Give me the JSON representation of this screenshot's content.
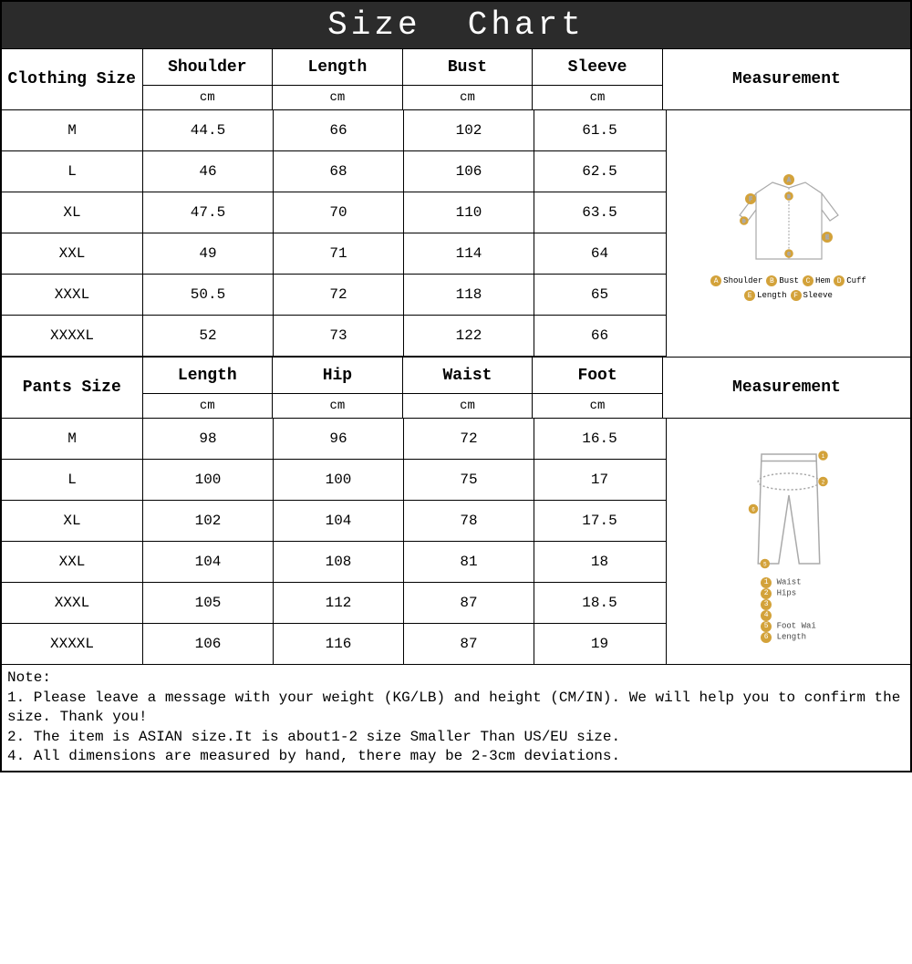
{
  "title": "Size  Chart",
  "clothing": {
    "sizeLabel": "Clothing Size",
    "headers": [
      "Shoulder",
      "Length",
      "Bust",
      "Sleeve"
    ],
    "unit": "cm",
    "measurementLabel": "Measurement",
    "rows": [
      {
        "size": "M",
        "v": [
          "44.5",
          "66",
          "102",
          "61.5"
        ]
      },
      {
        "size": "L",
        "v": [
          "46",
          "68",
          "106",
          "62.5"
        ]
      },
      {
        "size": "XL",
        "v": [
          "47.5",
          "70",
          "110",
          "63.5"
        ]
      },
      {
        "size": "XXL",
        "v": [
          "49",
          "71",
          "114",
          "64"
        ]
      },
      {
        "size": "XXXL",
        "v": [
          "50.5",
          "72",
          "118",
          "65"
        ]
      },
      {
        "size": "XXXXL",
        "v": [
          "52",
          "73",
          "122",
          "66"
        ]
      }
    ],
    "legend": [
      {
        "k": "A",
        "t": "Shoulder"
      },
      {
        "k": "B",
        "t": "Bust"
      },
      {
        "k": "C",
        "t": "Hem"
      },
      {
        "k": "D",
        "t": "Cuff"
      },
      {
        "k": "E",
        "t": "Length"
      },
      {
        "k": "F",
        "t": "Sleeve"
      }
    ]
  },
  "pants": {
    "sizeLabel": "Pants Size",
    "headers": [
      "Length",
      "Hip",
      "Waist",
      "Foot"
    ],
    "unit": "cm",
    "measurementLabel": "Measurement",
    "rows": [
      {
        "size": "M",
        "v": [
          "98",
          "96",
          "72",
          "16.5"
        ]
      },
      {
        "size": "L",
        "v": [
          "100",
          "100",
          "75",
          "17"
        ]
      },
      {
        "size": "XL",
        "v": [
          "102",
          "104",
          "78",
          "17.5"
        ]
      },
      {
        "size": "XXL",
        "v": [
          "104",
          "108",
          "81",
          "18"
        ]
      },
      {
        "size": "XXXL",
        "v": [
          "105",
          "112",
          "87",
          "18.5"
        ]
      },
      {
        "size": "XXXXL",
        "v": [
          "106",
          "116",
          "87",
          "19"
        ]
      }
    ],
    "legend": [
      {
        "k": "1",
        "t": "Waist"
      },
      {
        "k": "2",
        "t": "Hips"
      },
      {
        "k": "3",
        "t": ""
      },
      {
        "k": "4",
        "t": ""
      },
      {
        "k": "5",
        "t": "Foot Wai"
      },
      {
        "k": "6",
        "t": "Length"
      }
    ]
  },
  "note": {
    "heading": "Note:",
    "lines": [
      "1. Please leave a message with your weight (KG/LB) and height (CM/IN). We will help you to confirm the size. Thank you!",
      "2. The item is ASIAN size.It is about1-2 size Smaller Than US/EU size.",
      "4. All dimensions are measured by hand, there may be 2-3cm deviations."
    ]
  }
}
